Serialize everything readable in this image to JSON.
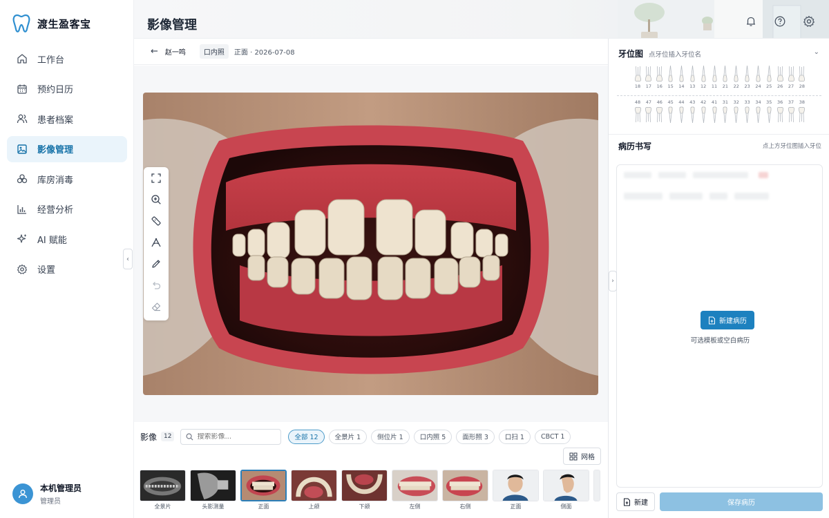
{
  "app": {
    "name": "渡生盈客宝"
  },
  "nav": [
    {
      "label": "工作台",
      "icon": "home-icon"
    },
    {
      "label": "预约日历",
      "icon": "calendar-icon"
    },
    {
      "label": "患者档案",
      "icon": "users-icon"
    },
    {
      "label": "影像管理",
      "icon": "image-icon",
      "active": true
    },
    {
      "label": "库房消毒",
      "icon": "biohazard-icon"
    },
    {
      "label": "经营分析",
      "icon": "bar-chart-icon"
    },
    {
      "label": "AI 赋能",
      "icon": "sparkle-icon"
    },
    {
      "label": "设置",
      "icon": "gear-icon"
    }
  ],
  "user": {
    "name": "本机管理员",
    "role": "管理员"
  },
  "header": {
    "title": "影像管理"
  },
  "subbar": {
    "patient": "赵一鸣",
    "type": "口内照",
    "meta": "正面 · 2026-07-08"
  },
  "gallery": {
    "title": "影像",
    "count": "12",
    "search_placeholder": "搜索影像...",
    "filters": [
      "全部 12",
      "全景片 1",
      "侧位片 1",
      "口内照 5",
      "面形照 3",
      "口扫 1",
      "CBCT 1"
    ],
    "grid_label": "网格",
    "thumbs": [
      "全景片",
      "头影测量",
      "正面",
      "上颌",
      "下颌",
      "左侧",
      "右侧",
      "正面",
      "侧面"
    ]
  },
  "tooth_chart": {
    "title": "牙位图",
    "hint": "点牙位插入牙位名",
    "upper": [
      "18",
      "17",
      "16",
      "15",
      "14",
      "13",
      "12",
      "11",
      "21",
      "22",
      "23",
      "24",
      "25",
      "26",
      "27",
      "28"
    ],
    "lower": [
      "48",
      "47",
      "46",
      "45",
      "44",
      "43",
      "42",
      "41",
      "31",
      "32",
      "33",
      "34",
      "35",
      "36",
      "37",
      "38"
    ]
  },
  "record": {
    "title": "病历书写",
    "hint": "点上方牙位图插入牙位",
    "new_button": "新建病历",
    "new_hint": "可选模板或空白病历",
    "btn_new": "新建",
    "btn_save": "保存病历"
  },
  "colors": {
    "accent": "#1d81bf",
    "active_bg": "#eaf4fb",
    "save_disabled": "#8dc1e2"
  }
}
